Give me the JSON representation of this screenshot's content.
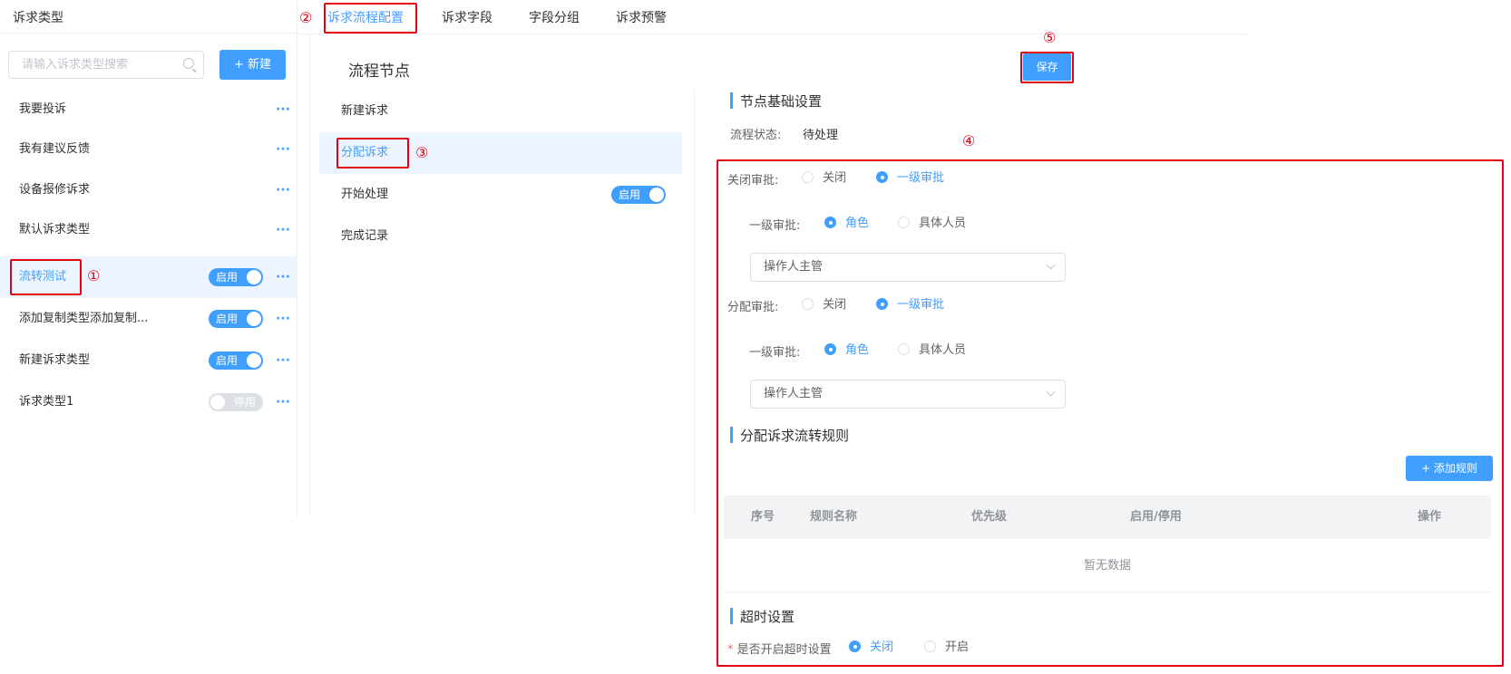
{
  "left": {
    "title": "诉求类型",
    "search_placeholder": "请输入诉求类型搜索",
    "new_button": "+ 新建",
    "items": [
      {
        "label": "我要投诉",
        "toggle": null
      },
      {
        "label": "我有建议反馈",
        "toggle": null
      },
      {
        "label": "设备报修诉求",
        "toggle": null
      },
      {
        "label": "默认诉求类型",
        "toggle": null
      },
      {
        "label": "流转测试",
        "toggle": "启用"
      },
      {
        "label": "添加复制类型添加复制...",
        "toggle": "启用"
      },
      {
        "label": "新建诉求类型",
        "toggle": "启用"
      },
      {
        "label": "诉求类型1",
        "toggle": "停用"
      }
    ],
    "dots": "···"
  },
  "tabs": [
    "诉求流程配置",
    "诉求字段",
    "字段分组",
    "诉求预警"
  ],
  "markers": [
    "①",
    "②",
    "③",
    "④",
    "⑤"
  ],
  "middle": {
    "title": "流程节点",
    "nodes": [
      {
        "label": "新建诉求"
      },
      {
        "label": "分配诉求"
      },
      {
        "label": "开始处理",
        "toggle": "启用"
      },
      {
        "label": "完成记录"
      }
    ]
  },
  "right": {
    "save": "保存",
    "basic_title": "节点基础设置",
    "status_label": "流程状态:",
    "status_value": "待处理",
    "close_approval_label": "关闭审批:",
    "opt_close": "关闭",
    "opt_level1": "一级审批",
    "level1_label": "一级审批:",
    "opt_role": "角色",
    "opt_person": "具体人员",
    "select_value": "操作人主管",
    "assign_approval_label": "分配审批:",
    "rule_title": "分配诉求流转规则",
    "add_rule": "+ 添加规则",
    "columns": [
      "序号",
      "规则名称",
      "优先级",
      "启用/停用",
      "操作"
    ],
    "empty": "暂无数据",
    "timeout_title": "超时设置",
    "timeout_required": "*",
    "timeout_label": "是否开启超时设置",
    "opt_off": "关闭",
    "opt_on": "开启"
  },
  "colors": {
    "accent": "#409eff",
    "annotation": "#e60012"
  }
}
